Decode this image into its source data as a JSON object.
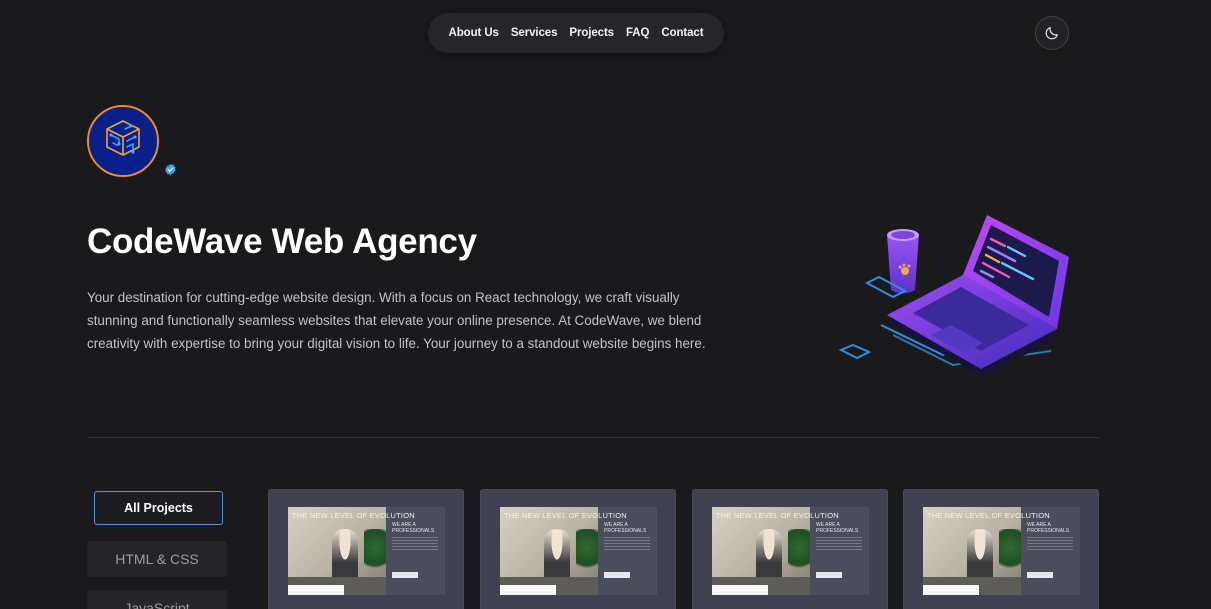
{
  "nav": {
    "links": [
      "About Us",
      "Services",
      "Projects",
      "FAQ",
      "Contact"
    ]
  },
  "theme_toggle": {
    "icon": "moon-icon"
  },
  "hero": {
    "title": "CodeWave Web Agency",
    "description": "Your destination for cutting-edge website design. With a focus on React technology, we craft visually stunning and functionally seamless websites that elevate your online presence. At CodeWave, we blend creativity with expertise to bring your digital vision to life. Your journey to a standout website begins here.",
    "avatar_icon": "circuit-cube-icon",
    "verified_icon": "verified-check-icon",
    "illustration_icon": "laptop-coffee-illustration"
  },
  "filters": [
    "All Projects",
    "HTML & CSS",
    "JavaScript"
  ],
  "projects": [
    {
      "headline": "THE NEW LEVEL OF EVOLUTION",
      "side": "WE ARE A PROFESSIONALS"
    },
    {
      "headline": "THE NEW LEVEL OF EVOLUTION",
      "side": "WE ARE A PROFESSIONALS"
    },
    {
      "headline": "THE NEW LEVEL OF EVOLUTION",
      "side": "WE ARE A PROFESSIONALS"
    },
    {
      "headline": "THE NEW LEVEL OF EVOLUTION",
      "side": "WE ARE A PROFESSIONALS"
    }
  ],
  "colors": {
    "background": "#1a191c",
    "nav_bg": "#26252a",
    "avatar_ring": "#e6902d",
    "avatar_bg": "#0a1f8a",
    "active_filter_border": "#5d8fd6",
    "card_bg": "#3f4150"
  }
}
